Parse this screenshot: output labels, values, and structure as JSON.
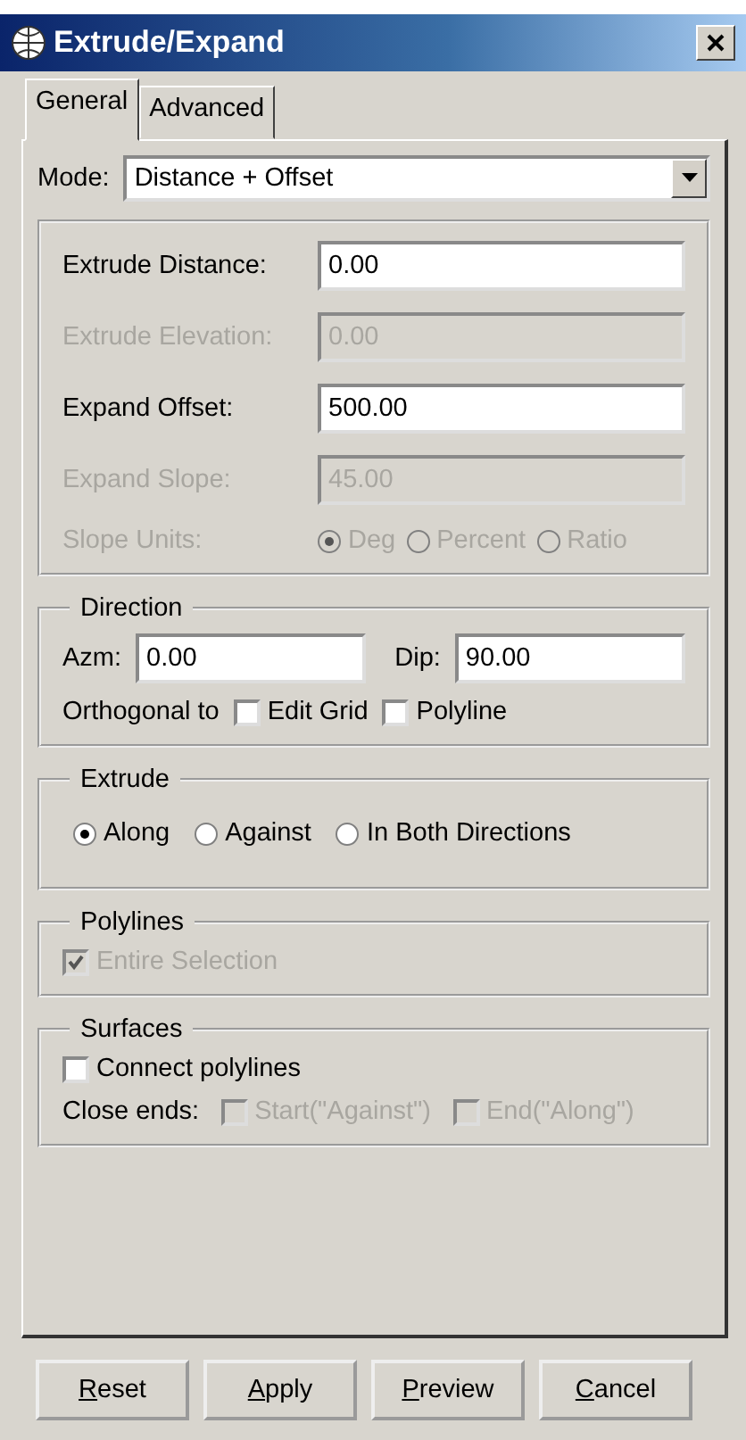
{
  "window": {
    "title": "Extrude/Expand"
  },
  "tabs": [
    {
      "label": "General",
      "selected": true
    },
    {
      "label": "Advanced",
      "selected": false
    }
  ],
  "mode": {
    "label": "Mode:",
    "value": "Distance + Offset"
  },
  "fields": [
    {
      "label": "Extrude Distance:",
      "value": "0.00",
      "disabled": false
    },
    {
      "label": "Extrude Elevation:",
      "value": "0.00",
      "disabled": true
    },
    {
      "label": "Expand Offset:",
      "value": "500.00",
      "disabled": false
    },
    {
      "label": "Expand Slope:",
      "value": "45.00",
      "disabled": true
    }
  ],
  "slope_units": {
    "label": "Slope Units:",
    "disabled": true,
    "options": [
      {
        "label": "Deg",
        "selected": true
      },
      {
        "label": "Percent",
        "selected": false
      },
      {
        "label": "Ratio",
        "selected": false
      }
    ]
  },
  "direction": {
    "title": "Direction",
    "azm": {
      "label": "Azm:",
      "value": "0.00"
    },
    "dip": {
      "label": "Dip:",
      "value": "90.00"
    },
    "orthogonal": {
      "label": "Orthogonal to",
      "options": [
        {
          "label": "Edit Grid",
          "checked": false
        },
        {
          "label": "Polyline",
          "checked": false
        }
      ]
    }
  },
  "extrude": {
    "title": "Extrude",
    "options": [
      {
        "label": "Along",
        "selected": true
      },
      {
        "label": "Against",
        "selected": false
      },
      {
        "label": "In Both Directions",
        "selected": false
      }
    ]
  },
  "polylines": {
    "title": "Polylines",
    "option": {
      "label": "Entire Selection",
      "checked": true,
      "disabled": true
    }
  },
  "surfaces": {
    "title": "Surfaces",
    "connect": {
      "label": "Connect polylines",
      "checked": false,
      "disabled": false
    },
    "close_ends": {
      "label": "Close ends:",
      "options": [
        {
          "label": "Start(\"Against\")",
          "checked": false,
          "disabled": true
        },
        {
          "label": "End(\"Along\")",
          "checked": false,
          "disabled": true
        }
      ]
    }
  },
  "buttons": [
    {
      "label": "Reset"
    },
    {
      "label": "Apply"
    },
    {
      "label": "Preview"
    },
    {
      "label": "Cancel"
    }
  ]
}
